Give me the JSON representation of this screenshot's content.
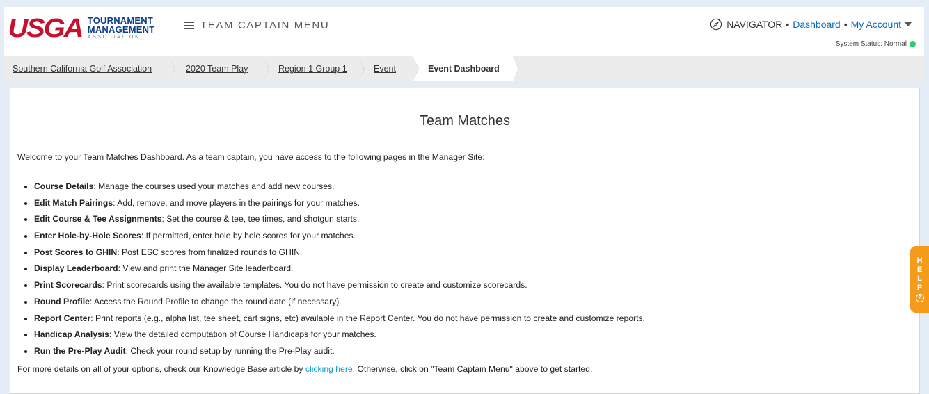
{
  "header": {
    "logo": {
      "usga": "USGA",
      "line1": "TOURNAMENT",
      "line2": "MANAGEMENT",
      "line3": "ASSOCIATION"
    },
    "menu_label": "TEAM CAPTAIN MENU",
    "nav": {
      "navigator": "NAVIGATOR",
      "separator": "•",
      "dashboard": "Dashboard",
      "account": "My Account"
    },
    "status": {
      "label": "System Status: Normal",
      "color": "#2ecc71"
    }
  },
  "breadcrumb": [
    "Southern California Golf Association",
    "2020 Team Play",
    "Region 1 Group 1",
    "Event",
    "Event Dashboard"
  ],
  "main": {
    "title": "Team Matches",
    "intro": "Welcome to your Team Matches Dashboard. As a team captain, you have access to the following pages in the Manager Site:",
    "items": [
      {
        "name": "Course Details",
        "desc": ": Manage the courses used your matches and add new courses."
      },
      {
        "name": "Edit Match Pairings",
        "desc": ": Add, remove, and move players in the pairings for your matches."
      },
      {
        "name": "Edit Course & Tee Assignments",
        "desc": ": Set the course & tee, tee times, and shotgun starts."
      },
      {
        "name": "Enter Hole-by-Hole Scores",
        "desc": ": If permitted, enter hole by hole scores for your matches."
      },
      {
        "name": "Post Scores to GHIN",
        "desc": ": Post ESC scores from finalized rounds to GHIN."
      },
      {
        "name": "Display Leaderboard",
        "desc": ": View and print the Manager Site leaderboard."
      },
      {
        "name": "Print Scorecards",
        "desc": ": Print scorecards using the available templates. You do not have permission to create and customize scorecards."
      },
      {
        "name": "Round Profile",
        "desc": ": Access the Round Profile to change the round date (if necessary)."
      },
      {
        "name": "Report Center",
        "desc": ": Print reports (e.g., alpha list, tee sheet, cart signs, etc) available in the Report Center. You do not have permission to create and customize reports."
      },
      {
        "name": "Handicap Analysis",
        "desc": ": View the detailed computation of Course Handicaps for your matches."
      },
      {
        "name": "Run the Pre-Play Audit",
        "desc": ": Check your round setup by running the Pre-Play audit."
      }
    ],
    "outro_before": "For more details on all of your options, check our Knowledge Base article by ",
    "outro_link": "clicking here.",
    "outro_after": " Otherwise, click on \"Team Captain Menu\" above to get started."
  },
  "help_tab": {
    "letters": [
      "H",
      "E",
      "L",
      "P"
    ],
    "icon": "?"
  },
  "colors": {
    "brand_red": "#c8102e",
    "brand_blue": "#0b3f87",
    "link": "#0b6bbf",
    "help": "#f49b1b"
  }
}
